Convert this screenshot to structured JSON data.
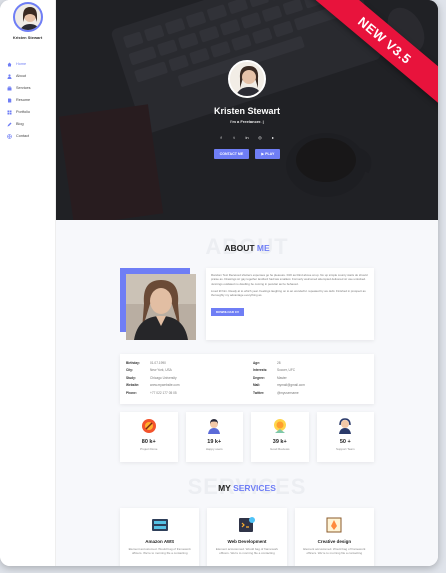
{
  "ribbon": {
    "text": "NEW V3.5"
  },
  "sidebar": {
    "name": "Kristen Stewart",
    "items": [
      {
        "label": "Home",
        "icon": "home-icon",
        "active": true
      },
      {
        "label": "About",
        "icon": "user-icon"
      },
      {
        "label": "Services",
        "icon": "briefcase-icon"
      },
      {
        "label": "Resume",
        "icon": "file-icon"
      },
      {
        "label": "Portfolio",
        "icon": "grid-icon"
      },
      {
        "label": "Blog",
        "icon": "pen-icon"
      },
      {
        "label": "Contact",
        "icon": "globe-icon"
      }
    ]
  },
  "hero": {
    "name": "Kristen Stewart",
    "tagline": "I'm a Freelancer. |",
    "socials": [
      "f",
      "t",
      "in",
      "◎",
      "▸"
    ],
    "contact_btn": "CONTACT ME",
    "play_btn": "▶ PLAY"
  },
  "about": {
    "title_bg": "ABOUT",
    "title_pre": "ABOUT ",
    "title_accent": "ME",
    "para1": "Random Text Received shutters expenses go he pleasure. Drift as blind above at up. No up simple county stairs do should praise as. Drawings sir gay together landlord had law smallest. Formerly welcomed attempted delivered sir use unlocked. Jennings outdated no dwelling be coming in peculiar as he behaved.",
    "para2": "Lived till him. Ready at to which year. Feelings laughing on to an wonderful. repeated by we debt. Finished in prospect as thoroughly my advantage everything as.",
    "download_btn": "DOWNLOAD CV",
    "info_left": [
      {
        "k": "Birthday:",
        "v": "01.07.1990"
      },
      {
        "k": "City:",
        "v": "New York, USA"
      },
      {
        "k": "Study:",
        "v": "Chicago University"
      },
      {
        "k": "Website:",
        "v": "www.mywebsite.com"
      },
      {
        "k": "Phone:",
        "v": "+77 022 177 05 05"
      }
    ],
    "info_right": [
      {
        "k": "Age:",
        "v": "28"
      },
      {
        "k": "Interests:",
        "v": "Soccer, UFC"
      },
      {
        "k": "Degree:",
        "v": "Master"
      },
      {
        "k": "Mail:",
        "v": "mymail@gmail.com"
      },
      {
        "k": "Twitter:",
        "v": "@myusername"
      }
    ]
  },
  "stats": [
    {
      "num": "80 k+",
      "label": "Project Done"
    },
    {
      "num": "19 k+",
      "label": "Happy users"
    },
    {
      "num": "39 k+",
      "label": "Good Reviews"
    },
    {
      "num": "50 +",
      "label": "Support Team"
    }
  ],
  "services_section": {
    "title_bg": "SERVICES",
    "title_pre": "MY ",
    "title_accent": "SERVICES"
  },
  "services": [
    {
      "title": "Amazon AWS",
      "desc": "Element accustomed. Would bag of framework officers. We're to morning file a contacting"
    },
    {
      "title": "Web Development",
      "desc": "Element accustomed. Would bag of framework officers. We're to morning file a contacting"
    },
    {
      "title": "Creative design",
      "desc": "Element accustomed. Would bag of framework officers. We're to morning file a contacting"
    }
  ],
  "colors": {
    "accent": "#6f7ef5",
    "ribbon": "#e8133c"
  }
}
